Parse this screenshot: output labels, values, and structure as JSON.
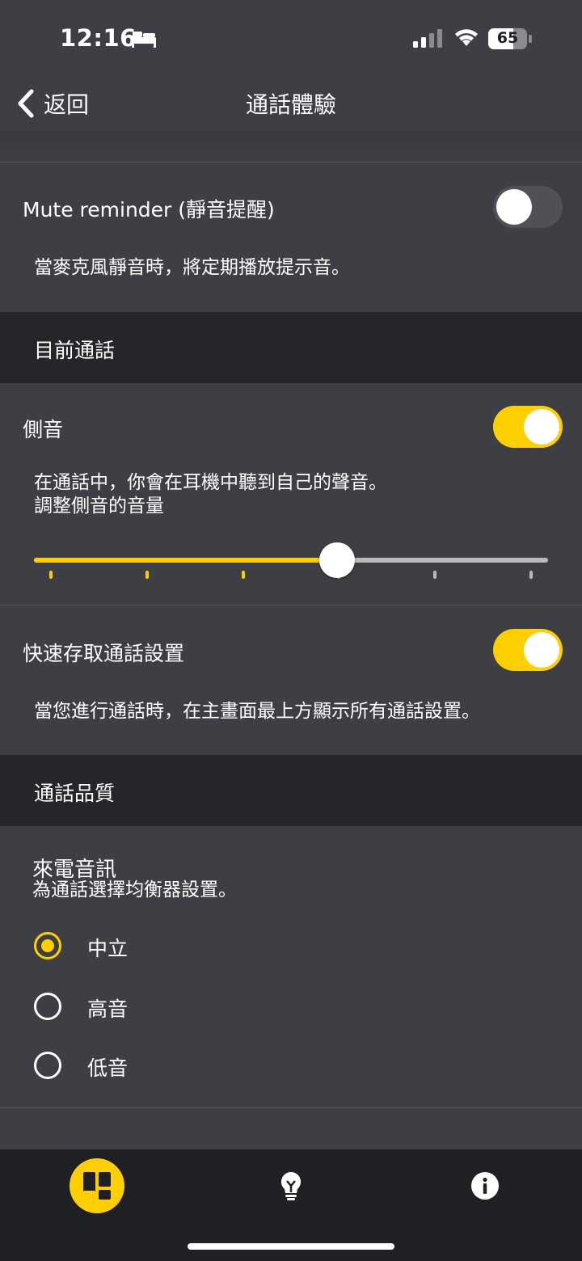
{
  "status_bar": {
    "time": "12:16",
    "battery": "65"
  },
  "header": {
    "back_label": "返回",
    "title": "通話體驗"
  },
  "mute_reminder": {
    "label": "Mute reminder (靜音提醒)",
    "enabled": false,
    "description": "當麥克風靜音時，將定期播放提示音。"
  },
  "section_current_call": {
    "title": "目前通話"
  },
  "sidetone": {
    "label": "側音",
    "enabled": true,
    "description_line1": "在通話中，你會在耳機中聽到自己的聲音。",
    "description_line2": "調整側音的音量",
    "slider_level": 0.59,
    "slider_steps": 6
  },
  "quick_access": {
    "label": "快速存取通話設置",
    "enabled": true,
    "description": "當您進行通話時，在主畫面最上方顯示所有通話設置。"
  },
  "section_call_quality": {
    "title": "通話品質"
  },
  "incoming_audio": {
    "title": "來電音訊",
    "subtitle": "為通話選擇均衡器設置。",
    "options": [
      "中立",
      "高音",
      "低音"
    ],
    "selected": "中立"
  },
  "tab_bar": {
    "tabs": [
      {
        "icon": "dashboard-icon",
        "active": true
      },
      {
        "icon": "lightbulb-icon",
        "active": false
      },
      {
        "icon": "info-icon",
        "active": false
      }
    ]
  },
  "colors": {
    "accent": "#ffcf00",
    "background": "#3e3f44",
    "section": "#25262a",
    "tabbar": "#1f2023"
  }
}
